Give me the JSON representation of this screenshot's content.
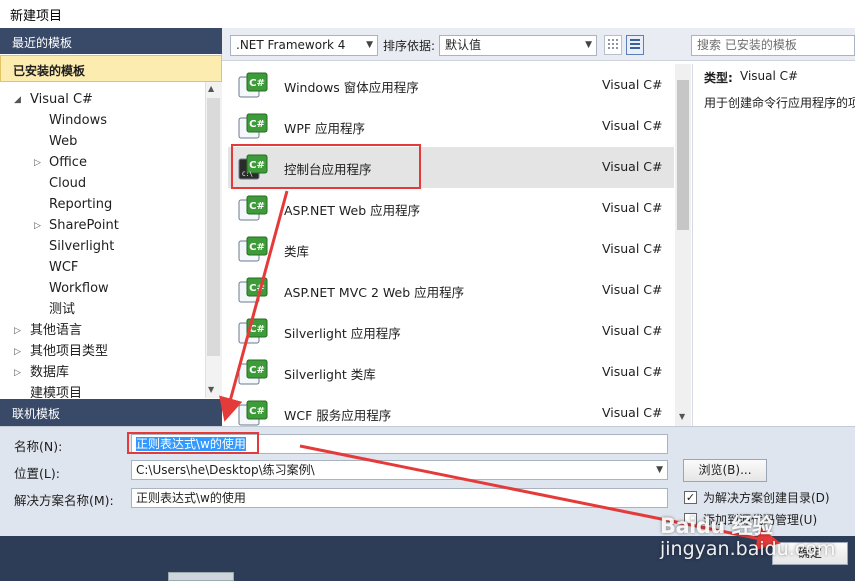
{
  "window": {
    "title": "新建项目"
  },
  "left": {
    "recent_label": "最近的模板",
    "installed_label": "已安装的模板",
    "tree": [
      {
        "label": "Visual C#",
        "arrow": "◢",
        "level": 0
      },
      {
        "label": "Windows",
        "arrow": "",
        "level": 1
      },
      {
        "label": "Web",
        "arrow": "",
        "level": 1
      },
      {
        "label": "Office",
        "arrow": "▷",
        "level": 1
      },
      {
        "label": "Cloud",
        "arrow": "",
        "level": 1
      },
      {
        "label": "Reporting",
        "arrow": "",
        "level": 1
      },
      {
        "label": "SharePoint",
        "arrow": "▷",
        "level": 1
      },
      {
        "label": "Silverlight",
        "arrow": "",
        "level": 1
      },
      {
        "label": "WCF",
        "arrow": "",
        "level": 1
      },
      {
        "label": "Workflow",
        "arrow": "",
        "level": 1
      },
      {
        "label": "测试",
        "arrow": "",
        "level": 1
      },
      {
        "label": "其他语言",
        "arrow": "▷",
        "level": 0
      },
      {
        "label": "其他项目类型",
        "arrow": "▷",
        "level": 0
      },
      {
        "label": "数据库",
        "arrow": "▷",
        "level": 0
      },
      {
        "label": "建模项目",
        "arrow": "",
        "level": 0
      }
    ],
    "online_label": "联机模板"
  },
  "toolbar": {
    "framework": ".NET Framework 4",
    "sort_label": "排序依据:",
    "sort_value": "默认值",
    "search_placeholder": "搜索 已安装的模板"
  },
  "templates": [
    {
      "name": "Windows 窗体应用程序",
      "lang": "Visual C#",
      "icon": "windows-forms-icon"
    },
    {
      "name": "WPF 应用程序",
      "lang": "Visual C#",
      "icon": "wpf-icon"
    },
    {
      "name": "控制台应用程序",
      "lang": "Visual C#",
      "icon": "console-app-icon"
    },
    {
      "name": "ASP.NET Web 应用程序",
      "lang": "Visual C#",
      "icon": "aspnet-web-icon"
    },
    {
      "name": "类库",
      "lang": "Visual C#",
      "icon": "class-library-icon"
    },
    {
      "name": "ASP.NET MVC 2 Web 应用程序",
      "lang": "Visual C#",
      "icon": "aspnet-mvc-icon"
    },
    {
      "name": "Silverlight 应用程序",
      "lang": "Visual C#",
      "icon": "silverlight-app-icon"
    },
    {
      "name": "Silverlight 类库",
      "lang": "Visual C#",
      "icon": "silverlight-library-icon"
    },
    {
      "name": "WCF 服务应用程序",
      "lang": "Visual C#",
      "icon": "wcf-service-icon"
    }
  ],
  "selected_index": 2,
  "info": {
    "type_label": "类型:",
    "type_value": "Visual C#",
    "description": "用于创建命令行应用程序的项"
  },
  "form": {
    "name_label": "名称(N):",
    "name_value": "正则表达式\\w的使用",
    "location_label": "位置(L):",
    "location_value": "C:\\Users\\he\\Desktop\\练习案例\\",
    "solution_label": "解决方案名称(M):",
    "solution_value": "正则表达式\\w的使用",
    "browse_label": "浏览(B)...",
    "create_dir_label": "为解决方案创建目录(D)",
    "create_dir_checked": true,
    "add_source_label": "添加到源代码管理(U)",
    "add_source_checked": false,
    "ok_label": "确定"
  },
  "watermark": {
    "line1": "Baidu 经验",
    "line2": "jingyan.baidu.com"
  },
  "colors": {
    "accent_dark": "#394a69",
    "installed_bg": "#fcecb0",
    "highlight_red": "#e53a3a"
  }
}
